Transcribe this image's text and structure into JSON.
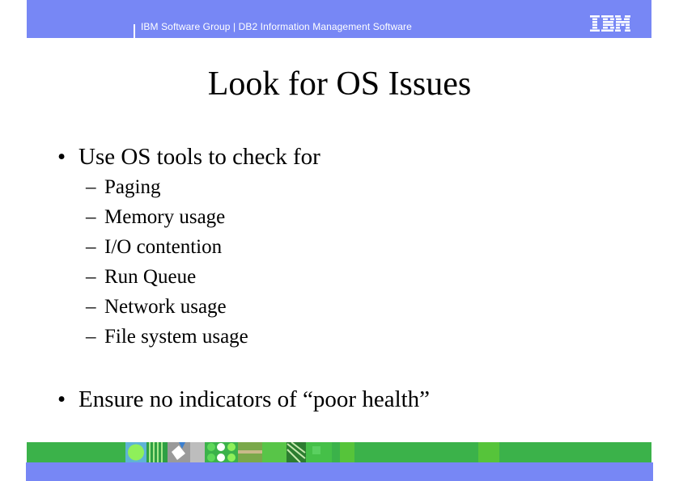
{
  "header": {
    "text": "IBM Software Group  |  DB2 Information Management Software",
    "logo": "IBM",
    "bar_color": "#7787f5"
  },
  "slide": {
    "title": "Look for OS Issues",
    "bullets": [
      {
        "marker": "•",
        "text": "Use OS tools to check for",
        "sub_marker": "–",
        "sub_items": [
          "Paging",
          "Memory usage",
          "I/O contention",
          "Run Queue",
          "Network usage",
          "File system usage"
        ]
      },
      {
        "marker": "•",
        "text": "Ensure no indicators of “poor health”"
      }
    ]
  },
  "footer": {
    "green_color": "#3bb24a",
    "blue_color": "#7787f5",
    "decoration": "ibm-image-strip"
  }
}
